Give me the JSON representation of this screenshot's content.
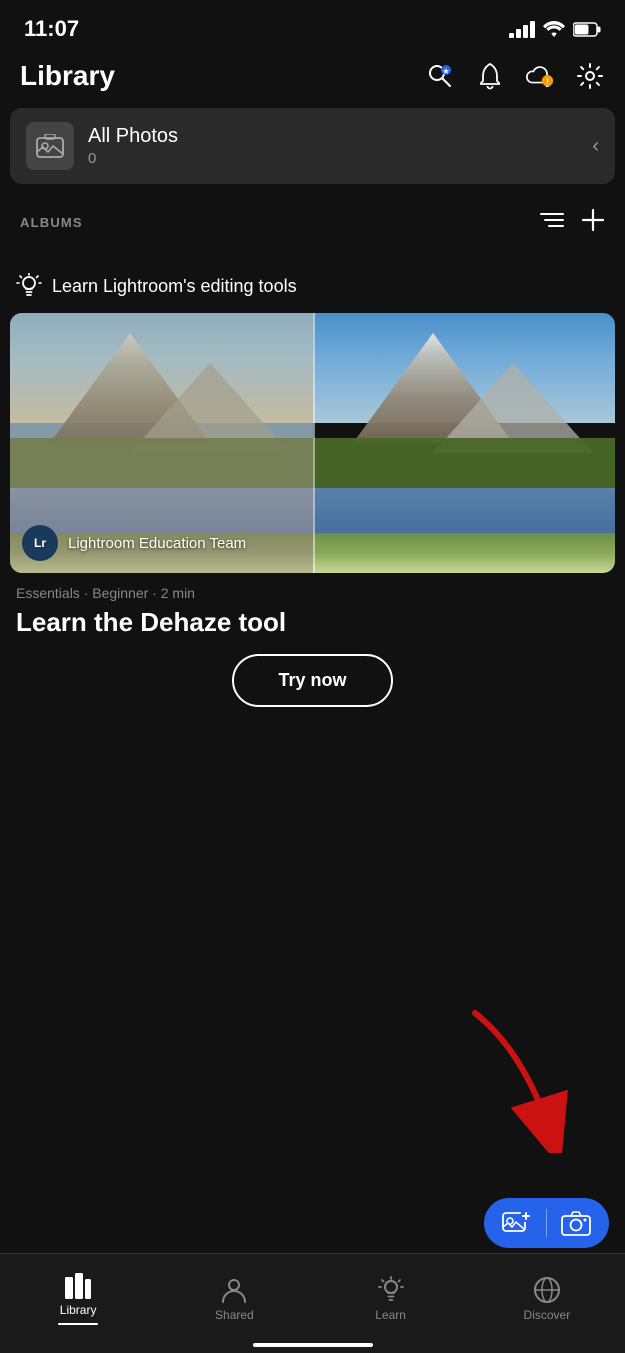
{
  "status": {
    "time": "11:07",
    "signal": 4,
    "wifi": true,
    "battery": 60
  },
  "header": {
    "title": "Library",
    "icons": {
      "search": "search-icon",
      "notification": "bell-icon",
      "cloud": "cloud-warning-icon",
      "settings": "settings-icon"
    }
  },
  "allPhotos": {
    "title": "All Photos",
    "count": "0",
    "chevron": "<"
  },
  "albums": {
    "title": "ALBUMS",
    "sort_label": "Sort",
    "add_label": "Add"
  },
  "learnSection": {
    "header": "Learn Lightroom's editing tools",
    "card": {
      "attribution": "Lightroom Education Team",
      "avatar": "Lr",
      "meta": "Essentials · Beginner · 2 min",
      "title": "Learn the Dehaze tool",
      "tryNow": "Try now"
    }
  },
  "bottomNav": {
    "items": [
      {
        "id": "library",
        "label": "Library",
        "active": true
      },
      {
        "id": "shared",
        "label": "Shared",
        "active": false
      },
      {
        "id": "learn",
        "label": "Learn",
        "active": false
      },
      {
        "id": "discover",
        "label": "Discover",
        "active": false
      }
    ]
  }
}
